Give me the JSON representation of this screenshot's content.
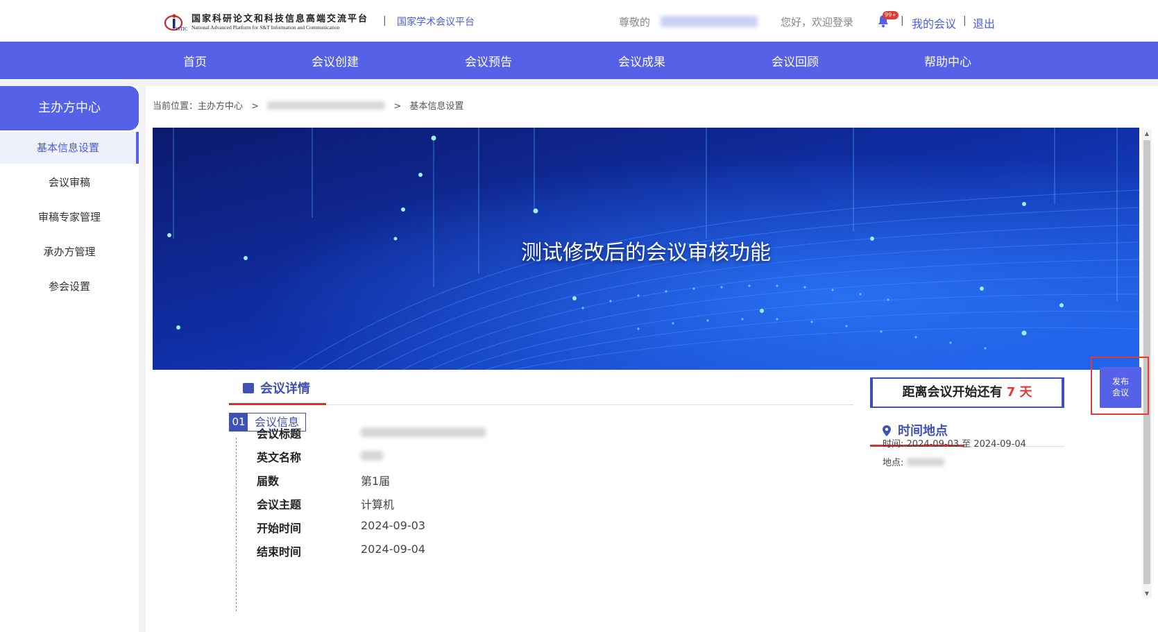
{
  "header": {
    "logo_mark": "ISTIC",
    "logo_cn": "国家科研论文和科技信息高端交流平台",
    "logo_en": "National Advanced Platform for S&T Information and Communication",
    "platform_link": "国家学术会议平台",
    "respect": "尊敬的",
    "greeting": "您好，欢迎登录",
    "bell_badge": "99+",
    "my_meetings": "我的会议",
    "logout": "退出",
    "sep": "|"
  },
  "nav": {
    "items": [
      "首页",
      "会议创建",
      "会议预告",
      "会议成果",
      "会议回顾",
      "帮助中心"
    ]
  },
  "sidebar": {
    "title": "主办方中心",
    "items": [
      {
        "label": "基本信息设置",
        "active": true
      },
      {
        "label": "会议审稿",
        "active": false
      },
      {
        "label": "审稿专家管理",
        "active": false
      },
      {
        "label": "承办方管理",
        "active": false
      },
      {
        "label": "参会设置",
        "active": false
      }
    ]
  },
  "breadcrumb": {
    "prefix": "当前位置：主办方中心",
    "arrow": ">",
    "current": "基本信息设置"
  },
  "banner": {
    "title": "测试修改后的会议审核功能"
  },
  "details": {
    "section_title": "会议详情",
    "sub_num": "01",
    "sub_label": "会议信息",
    "rows": [
      {
        "label": "会议标题",
        "value": ""
      },
      {
        "label": "英文名称",
        "value": ""
      },
      {
        "label": "届数",
        "value": "第1届"
      },
      {
        "label": "会议主题",
        "value": "计算机"
      },
      {
        "label": "开始时间",
        "value": "2024-09-03"
      },
      {
        "label": "结束时间",
        "value": "2024-09-04"
      }
    ]
  },
  "countdown": {
    "prefix": "距离会议开始还有",
    "days": "7 天"
  },
  "time_place": {
    "title": "时间地点",
    "time_label": "时间:",
    "time_value": "2024-09-03 至 2024-09-04",
    "place_label": "地点:"
  },
  "publish": {
    "line1": "发布",
    "line2": "会议"
  },
  "colors": {
    "primary": "#5561e6",
    "accent_red": "#e53935",
    "heading_blue": "#3f51b5"
  }
}
